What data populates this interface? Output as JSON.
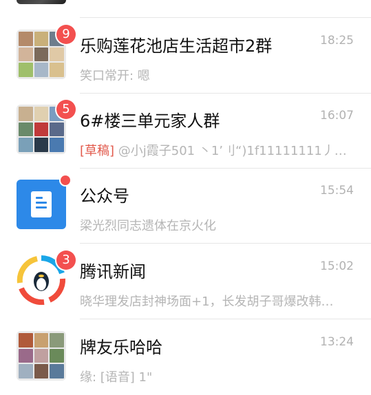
{
  "chats": [
    {
      "title": "乐购莲花池店生活超市2群",
      "time": "18:25",
      "preview": "笑口常开: 嗯",
      "badge": "9",
      "avatar": "group-grid",
      "tiles": [
        "#b48a6a",
        "#c9b07a",
        "#6d7d8c",
        "#d2b49a",
        "#7b6a5b",
        "#e0c9a6",
        "#9fbf6a",
        "#a7b7c8",
        "#d9c08e"
      ]
    },
    {
      "title": "6#楼三单元家人群",
      "time": "16:07",
      "draft_tag": "[草稿]",
      "preview": " @小j霞子501 丶1’刂“)1f11111111丿…",
      "badge": "5",
      "avatar": "group-grid",
      "tiles": [
        "#c8b090",
        "#e0d0b0",
        "#7a9cc0",
        "#6a8a6a",
        "#c03a3a",
        "#5a6a8a",
        "#7aa0b8",
        "#2a3a4a",
        "#4a7ab0"
      ]
    },
    {
      "title": "公众号",
      "time": "15:54",
      "preview": "梁光烈同志遗体在京火化",
      "dot": true,
      "avatar": "official-accounts-icon",
      "colors": {
        "bg": "#2d89e8"
      }
    },
    {
      "title": "腾讯新闻",
      "time": "15:02",
      "preview": "晓华理发店封神场面+1，长发胡子哥爆改韩…",
      "badge": "3",
      "avatar": "tencent-news-icon"
    },
    {
      "title": "牌友乐哈哈",
      "time": "13:24",
      "preview": "缘: [语音] 1\"",
      "avatar": "group-grid",
      "tiles": [
        "#b05a3a",
        "#c8a070",
        "#8a9a7a",
        "#9a6a8a",
        "#c0a0a0",
        "#6a8a5a",
        "#a0b0c0",
        "#7a5a4a",
        "#5a7a9a"
      ]
    }
  ],
  "colors": {
    "badge": "#f3504f",
    "title": "#111111",
    "subtle": "#b5b5b5",
    "draft": "#e25a4c"
  }
}
